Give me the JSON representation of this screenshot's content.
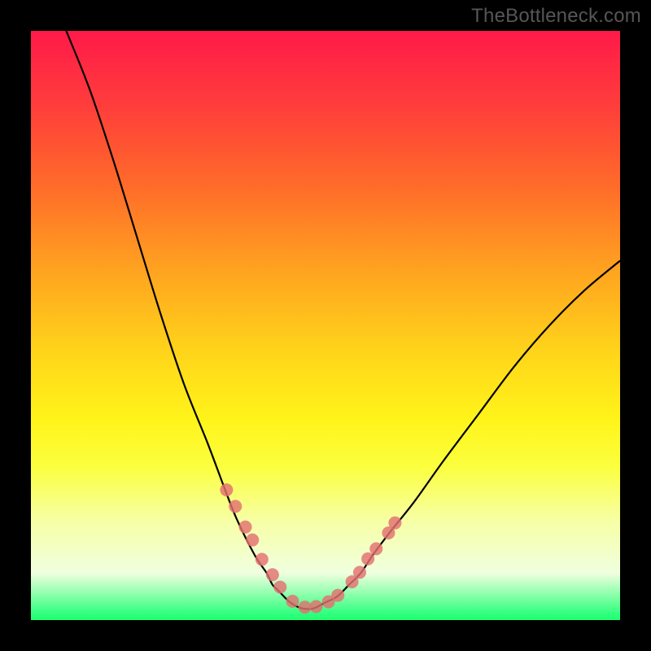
{
  "watermark": "TheBottleneck.com",
  "colors": {
    "background": "#000000",
    "gradient_top": "#ff1a49",
    "gradient_bottom": "#1fff70",
    "curve": "#000000",
    "dot": "#e37070"
  },
  "chart_data": {
    "type": "line",
    "title": "",
    "xlabel": "",
    "ylabel": "",
    "xlim": [
      0,
      100
    ],
    "ylim": [
      0,
      100
    ],
    "grid": false,
    "curve_description": "Asymmetric V-shaped curve: falls steeply from upper-left corner to a flat minimum near x≈46, then rises to the right edge at roughly y≈60",
    "series": [
      {
        "name": "curve",
        "x": [
          6,
          10,
          14,
          18,
          22,
          26,
          30,
          33,
          35,
          38,
          40,
          41,
          42,
          44,
          46,
          48,
          50,
          52,
          54,
          56,
          58,
          61,
          65,
          70,
          76,
          82,
          88,
          94,
          100
        ],
        "y": [
          100,
          90,
          78,
          65,
          52,
          40,
          30,
          22,
          17,
          11,
          8,
          6,
          5,
          3,
          2,
          2,
          3,
          4,
          6,
          8,
          11,
          15,
          20,
          27,
          35,
          43,
          50,
          56,
          61
        ]
      }
    ],
    "points": {
      "name": "dots",
      "x": [
        33.2,
        34.7,
        36.4,
        37.6,
        39.2,
        41.0,
        42.3,
        44.4,
        46.5,
        48.4,
        50.5,
        52.1,
        54.5,
        55.8,
        57.2,
        58.6,
        60.7,
        61.8
      ],
      "y": [
        22.1,
        19.3,
        15.8,
        13.6,
        10.3,
        7.7,
        5.6,
        3.2,
        2.2,
        2.3,
        3.1,
        4.2,
        6.5,
        8.1,
        10.4,
        12.1,
        14.8,
        16.5
      ]
    }
  }
}
